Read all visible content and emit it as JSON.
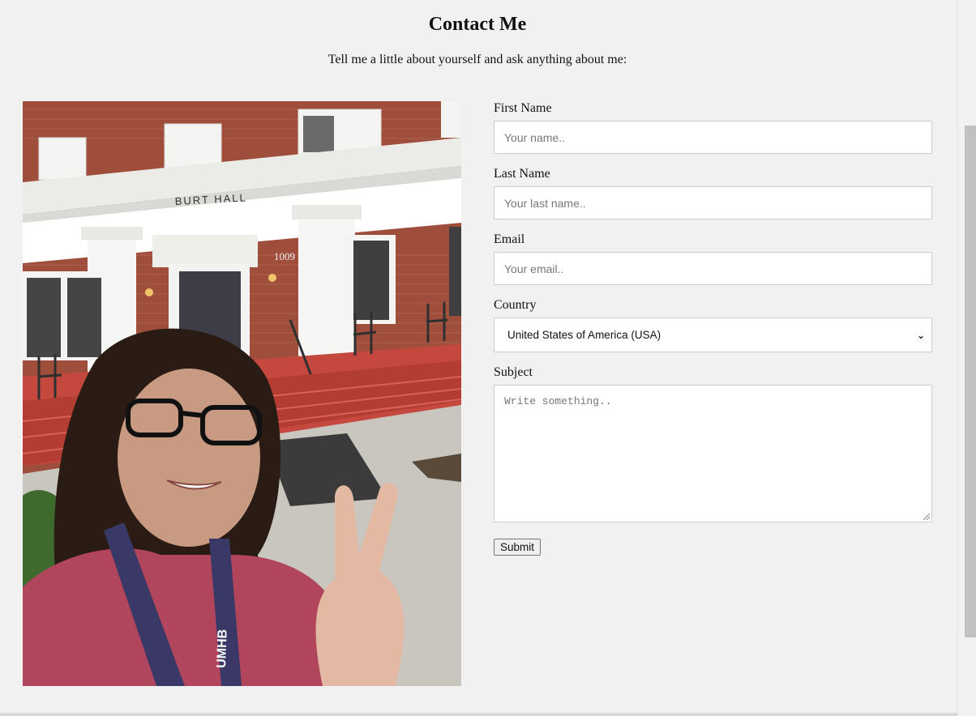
{
  "header": {
    "title": "Contact Me",
    "intro": "Tell me a little about yourself and ask anything about me:"
  },
  "photo": {
    "building_sign": "BURT HALL",
    "address_number": "1009",
    "lanyard_text": "UMHB"
  },
  "form": {
    "first_name": {
      "label": "First Name",
      "placeholder": "Your name.."
    },
    "last_name": {
      "label": "Last Name",
      "placeholder": "Your last name.."
    },
    "email": {
      "label": "Email",
      "placeholder": "Your email.."
    },
    "country": {
      "label": "Country",
      "selected": "United States of America (USA)"
    },
    "subject": {
      "label": "Subject",
      "placeholder": "Write something.."
    },
    "submit_label": "Submit"
  },
  "colors": {
    "background": "#f1f1f1",
    "input_border": "#cccccc",
    "scrollbar_thumb": "#c1c1c1"
  }
}
